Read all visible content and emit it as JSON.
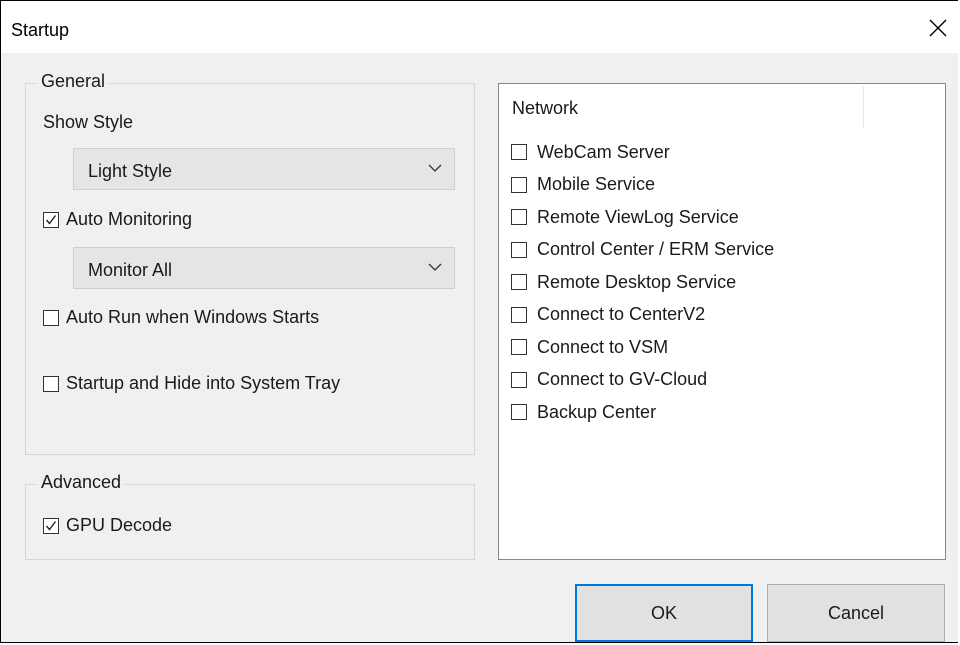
{
  "window": {
    "title": "Startup"
  },
  "general": {
    "legend": "General",
    "show_style_label": "Show Style",
    "style_value": "Light Style",
    "auto_monitoring": {
      "label": "Auto Monitoring",
      "checked": true
    },
    "monitor_value": "Monitor All",
    "auto_run": {
      "label": "Auto Run when Windows Starts",
      "checked": false
    },
    "hide_tray": {
      "label": "Startup and Hide into System Tray",
      "checked": false
    }
  },
  "advanced": {
    "legend": "Advanced",
    "gpu_decode": {
      "label": "GPU Decode",
      "checked": true
    }
  },
  "network": {
    "header": "Network",
    "items": [
      {
        "label": "WebCam Server",
        "checked": false
      },
      {
        "label": "Mobile Service",
        "checked": false
      },
      {
        "label": "Remote ViewLog Service",
        "checked": false
      },
      {
        "label": "Control Center / ERM Service",
        "checked": false
      },
      {
        "label": "Remote Desktop Service",
        "checked": false
      },
      {
        "label": "Connect to CenterV2",
        "checked": false
      },
      {
        "label": "Connect to VSM",
        "checked": false
      },
      {
        "label": "Connect to GV-Cloud",
        "checked": false
      },
      {
        "label": "Backup Center",
        "checked": false
      }
    ]
  },
  "buttons": {
    "ok": "OK",
    "cancel": "Cancel"
  },
  "icons": {
    "close": "close-icon",
    "dropdown": "chevron-down-icon",
    "check": "checkmark-icon"
  }
}
